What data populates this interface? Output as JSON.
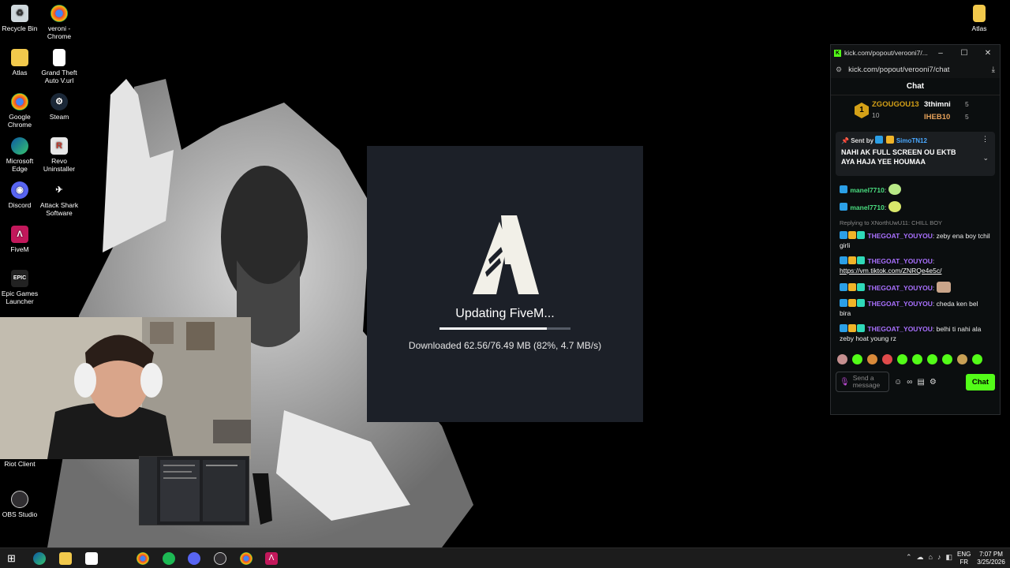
{
  "desktop": {
    "icons_left": [
      {
        "label": "Recycle Bin",
        "icon": "recycle-bin-icon"
      },
      {
        "label": "veroni - Chrome",
        "icon": "chrome-icon"
      },
      {
        "label": "Atlas",
        "icon": "folder-icon"
      },
      {
        "label": "Grand Theft Auto V.url",
        "icon": "file-icon"
      },
      {
        "label": "Google Chrome",
        "icon": "chrome-icon"
      },
      {
        "label": "Steam",
        "icon": "steam-icon"
      },
      {
        "label": "Microsoft Edge",
        "icon": "edge-icon"
      },
      {
        "label": "Revo Uninstaller",
        "icon": "revo-icon"
      },
      {
        "label": "Discord",
        "icon": "discord-icon"
      },
      {
        "label": "Attack Shark Software",
        "icon": "shark-icon"
      },
      {
        "label": "FiveM",
        "icon": "fivem-icon"
      },
      {
        "label": "Epic Games Launcher",
        "icon": "epic-icon"
      },
      {
        "label": "Riot Client",
        "icon": "riot-icon"
      },
      {
        "label": "OBS Studio",
        "icon": "obs-icon"
      }
    ],
    "icon_right": {
      "label": "Atlas",
      "icon": "folder-icon"
    }
  },
  "updater": {
    "title": "Updating FiveM...",
    "progress_fraction": 0.82,
    "status": "Downloaded 62.56/76.49 MB (82%, 4.7 MB/s)"
  },
  "chat_window": {
    "tab_title": "kick.com/popout/verooni7/...",
    "url": "kick.com/popout/verooni7/chat",
    "header": "Chat",
    "leaderboard": {
      "first_name": "ZGOUGOU13",
      "first_rank": "1",
      "first_count": "10",
      "second_name": "3thimni",
      "second_count": "5",
      "third_name": "IHEB10",
      "third_count": "5"
    },
    "pinned": {
      "sent_by_label": "Sent by",
      "sender": "SimoTN12",
      "text": "NAHI AK FULL SCREEN OU EKTB AYA HAJA YEE HOUMAA"
    },
    "messages": [
      {
        "user": "manel7710",
        "text": ":",
        "emote": true,
        "color": "#4ade80"
      },
      {
        "user": "manel7710",
        "text": ":",
        "emote": true,
        "color": "#4ade80"
      },
      {
        "reply": "Replying to XNorthUwU11: CHILL BOY"
      },
      {
        "user": "THEGOAT_YOUYOU",
        "text": ": zeby ena boy tchil girli",
        "color": "#a970ff"
      },
      {
        "user": "THEGOAT_YOUYOU",
        "text": ":",
        "link": "https://vm.tiktok.com/ZNRQe4e5c/",
        "color": "#a970ff"
      },
      {
        "user": "THEGOAT_YOUYOU",
        "text": ":",
        "emote": true,
        "color": "#a970ff"
      },
      {
        "user": "THEGOAT_YOUYOU",
        "text": ": cheda ken bel bira",
        "color": "#a970ff"
      },
      {
        "user": "THEGOAT_YOUYOU",
        "text": ": belhi ti nahi ala zeby hoat young rz",
        "color": "#a970ff"
      }
    ],
    "input_placeholder": "Send a message",
    "send_label": "Chat",
    "accent": "#53fc18"
  },
  "taskbar": {
    "lang_top": "ENG",
    "lang_bottom": "FR",
    "time": "7:07 PM",
    "date": "3/25/2026"
  }
}
